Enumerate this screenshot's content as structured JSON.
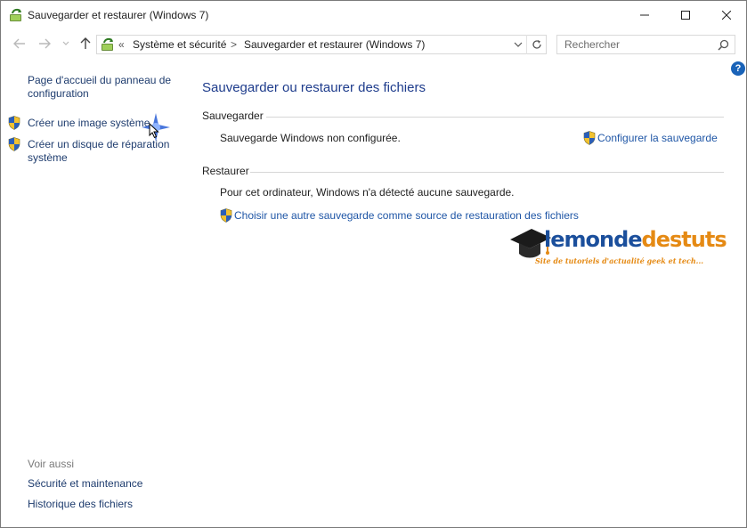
{
  "window": {
    "title": "Sauvegarder et restaurer (Windows 7)",
    "controls": {
      "minimize": "minimize",
      "maximize": "maximize",
      "close": "close"
    }
  },
  "navigation": {
    "back_icon": "arrow-left-icon",
    "forward_icon": "arrow-right-icon",
    "recent_icon": "chevron-down-icon",
    "up_icon": "arrow-up-icon"
  },
  "address": {
    "overflow": "«",
    "breadcrumb": [
      "Système et sécurité",
      "Sauvegarder et restaurer (Windows 7)"
    ],
    "separator": ">"
  },
  "search": {
    "placeholder": "Rechercher"
  },
  "help": {
    "label": "?"
  },
  "sidebar": {
    "home_link": "Page d'accueil du panneau de configuration",
    "tasks": [
      {
        "label": "Créer une image système",
        "icon": "uac-shield-icon"
      },
      {
        "label": "Créer un disque de réparation système",
        "icon": "uac-shield-icon"
      }
    ],
    "see_also_heading": "Voir aussi",
    "see_also": [
      "Sécurité et maintenance",
      "Historique des fichiers"
    ]
  },
  "main": {
    "title": "Sauvegarder ou restaurer des fichiers",
    "backup": {
      "heading": "Sauvegarder",
      "status": "Sauvegarde Windows non configurée.",
      "action": "Configurer la sauvegarde"
    },
    "restore": {
      "heading": "Restaurer",
      "status": "Pour cet ordinateur, Windows n'a détecté aucune sauvegarde.",
      "action": "Choisir une autre sauvegarde comme source de restauration des fichiers"
    }
  },
  "watermark": {
    "word_part1": "lemonde",
    "word_part2": "destuts",
    "tagline": "Site de tutoriels d'actualité geek et tech..."
  },
  "colors": {
    "link": "#1f56a6",
    "title": "#1e3c8c",
    "sidebar_link": "#1e3c6e",
    "muted": "#7a7a7a",
    "logo_blue": "#1b4f9c",
    "logo_orange": "#e58a14"
  }
}
